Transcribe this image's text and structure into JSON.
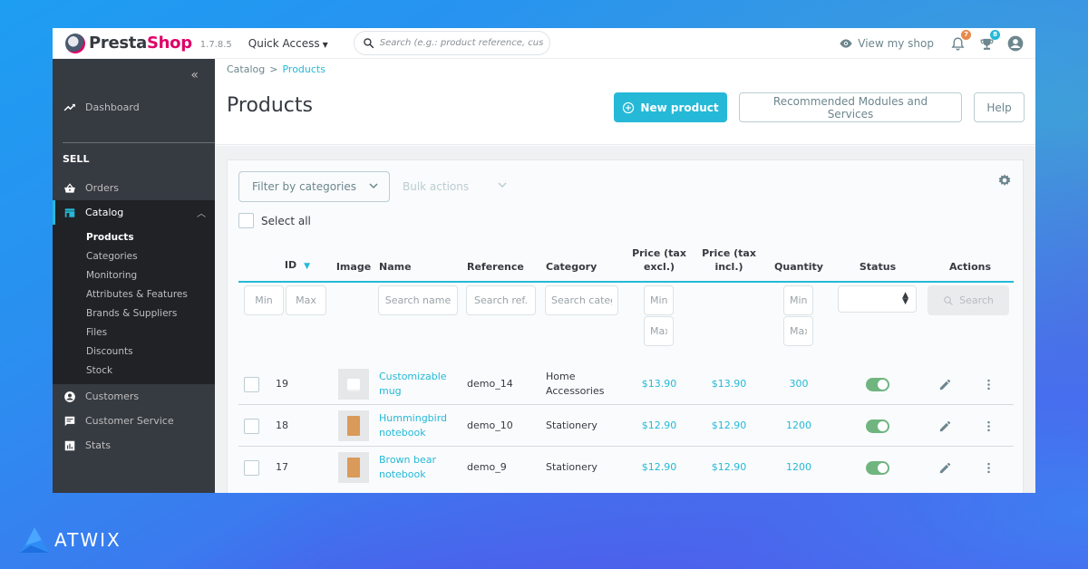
{
  "header": {
    "logo_part1": "Presta",
    "logo_part2": "Shop",
    "version": "1.7.8.5",
    "quick_access": "Quick Access",
    "search_placeholder": "Search (e.g.: product reference, custon",
    "view_shop": "View my shop",
    "notifications_count": "7",
    "trophy_count": "8",
    "icons": {
      "search": "search-icon",
      "eye": "eye-icon",
      "bell": "bell-icon",
      "trophy": "trophy-icon",
      "account": "account-icon"
    },
    "badge_colors": {
      "notifications": "#e9894b",
      "trophy": "#25b9d7"
    }
  },
  "sidebar": {
    "collapse_label": "«",
    "dashboard": "Dashboard",
    "section_sell": "SELL",
    "items": [
      {
        "label": "Orders",
        "icon": "basket-icon"
      },
      {
        "label": "Catalog",
        "icon": "store-icon",
        "active": true
      },
      {
        "label": "Customers",
        "icon": "account-circle-icon"
      },
      {
        "label": "Customer Service",
        "icon": "chat-icon"
      },
      {
        "label": "Stats",
        "icon": "bar-chart-icon"
      }
    ],
    "catalog_submenu": [
      {
        "label": "Products",
        "active": true
      },
      {
        "label": "Categories"
      },
      {
        "label": "Monitoring"
      },
      {
        "label": "Attributes & Features"
      },
      {
        "label": "Brands & Suppliers"
      },
      {
        "label": "Files"
      },
      {
        "label": "Discounts"
      },
      {
        "label": "Stock"
      }
    ]
  },
  "page": {
    "breadcrumb": [
      "Catalog",
      "Products"
    ],
    "breadcrumb_sep": ">",
    "title": "Products",
    "buttons": {
      "new_product": "New product",
      "recommended": "Recommended Modules and Services",
      "help": "Help"
    }
  },
  "toolbar": {
    "filter_categories": "Filter by categories",
    "bulk_actions": "Bulk actions",
    "select_all": "Select all"
  },
  "table": {
    "columns": [
      {
        "key": "id",
        "label": "ID",
        "sortable": true
      },
      {
        "key": "image",
        "label": "Image"
      },
      {
        "key": "name",
        "label": "Name"
      },
      {
        "key": "reference",
        "label": "Reference"
      },
      {
        "key": "category",
        "label": "Category"
      },
      {
        "key": "price_excl",
        "label_line1": "Price (tax",
        "label_line2": "excl.)"
      },
      {
        "key": "price_incl",
        "label_line1": "Price (tax",
        "label_line2": "incl.)"
      },
      {
        "key": "quantity",
        "label": "Quantity"
      },
      {
        "key": "status",
        "label": "Status"
      },
      {
        "key": "actions",
        "label": "Actions"
      }
    ],
    "filters": {
      "id_min_placeholder": "Min",
      "id_max_placeholder": "Max",
      "name_placeholder": "Search name",
      "reference_placeholder": "Search ref.",
      "category_placeholder": "Search category",
      "price_min_placeholder": "Min",
      "price_max_placeholder": "Max",
      "qty_min_placeholder": "Min",
      "qty_max_placeholder": "Max",
      "status_value": "",
      "search_button": "Search"
    },
    "rows": [
      {
        "id": "19",
        "image": "mug",
        "name_line1": "Customizable",
        "name_line2": "mug",
        "reference": "demo_14",
        "category_line1": "Home",
        "category_line2": "Accessories",
        "price_excl": "$13.90",
        "price_incl": "$13.90",
        "quantity": "300",
        "status": true
      },
      {
        "id": "18",
        "image": "notebook",
        "name_line1": "Hummingbird",
        "name_line2": "notebook",
        "reference": "demo_10",
        "category_line1": "Stationery",
        "category_line2": "",
        "price_excl": "$12.90",
        "price_incl": "$12.90",
        "quantity": "1200",
        "status": true
      },
      {
        "id": "17",
        "image": "notebook",
        "name_line1": "Brown bear",
        "name_line2": "notebook",
        "reference": "demo_9",
        "category_line1": "Stationery",
        "category_line2": "",
        "price_excl": "$12.90",
        "price_incl": "$12.90",
        "quantity": "1200",
        "status": true
      }
    ]
  },
  "brand": {
    "watermark": "ATWIX"
  },
  "colors": {
    "accent": "#25b9d7",
    "sidebar": "#363a41",
    "sidebar_active": "#202226",
    "status_on": "#70b580"
  }
}
